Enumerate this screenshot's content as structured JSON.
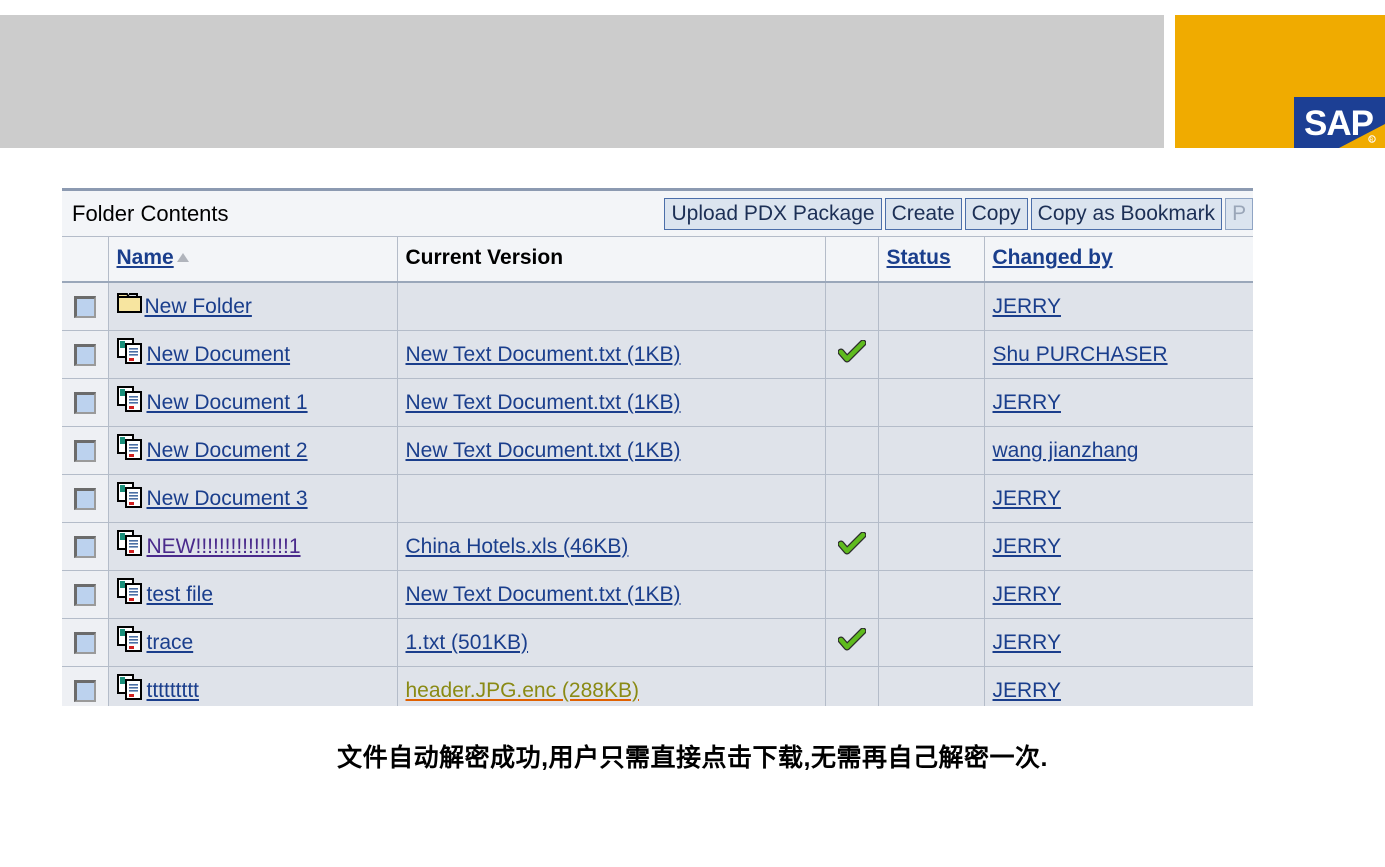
{
  "branding": {
    "logo_text": "SAP",
    "gold_color": "#f0ab00",
    "logo_blue": "#1c3f94",
    "banner_grey": "#cccccc"
  },
  "toolbar": {
    "title": "Folder Contents",
    "buttons": [
      {
        "label": "Upload PDX Package",
        "disabled": false
      },
      {
        "label": "Create",
        "disabled": false
      },
      {
        "label": "Copy",
        "disabled": false
      },
      {
        "label": "Copy as Bookmark",
        "disabled": false
      },
      {
        "label": "P",
        "disabled": true
      }
    ]
  },
  "table": {
    "columns": [
      {
        "key": "select",
        "label": "",
        "sortable": false
      },
      {
        "key": "name",
        "label": "Name",
        "sortable": true,
        "sorted": "asc"
      },
      {
        "key": "current_version",
        "label": "Current Version",
        "sortable": false
      },
      {
        "key": "flag",
        "label": "",
        "sortable": false
      },
      {
        "key": "status",
        "label": "Status",
        "sortable": true
      },
      {
        "key": "changed_by",
        "label": "Changed by",
        "sortable": true
      }
    ],
    "rows": [
      {
        "checked": false,
        "icon": "folder-icon",
        "name": "New Folder",
        "name_state": "normal",
        "current_version": "",
        "version_state": "normal",
        "flag": "",
        "status": "",
        "changed_by": "JERRY"
      },
      {
        "checked": false,
        "icon": "document-stack-icon",
        "name": "New Document",
        "name_state": "normal",
        "current_version": "New Text Document.txt (1KB)",
        "version_state": "normal",
        "flag": "check-mark-icon",
        "status": "",
        "changed_by": "Shu PURCHASER"
      },
      {
        "checked": false,
        "icon": "document-stack-icon",
        "name": "New Document 1",
        "name_state": "normal",
        "current_version": "New Text Document.txt (1KB)",
        "version_state": "normal",
        "flag": "",
        "status": "",
        "changed_by": "JERRY"
      },
      {
        "checked": false,
        "icon": "document-stack-icon",
        "name": "New Document 2",
        "name_state": "normal",
        "current_version": "New Text Document.txt (1KB)",
        "version_state": "normal",
        "flag": "",
        "status": "",
        "changed_by": "wang jianzhang"
      },
      {
        "checked": false,
        "icon": "document-stack-icon",
        "name": "New Document 3",
        "name_state": "normal",
        "current_version": "",
        "version_state": "normal",
        "flag": "",
        "status": "",
        "changed_by": "JERRY"
      },
      {
        "checked": false,
        "icon": "document-stack-icon",
        "name": "NEW!!!!!!!!!!!!!!!!1",
        "name_state": "visited",
        "current_version": "China Hotels.xls (46KB)",
        "version_state": "normal",
        "flag": "check-mark-icon",
        "status": "",
        "changed_by": "JERRY"
      },
      {
        "checked": false,
        "icon": "document-stack-icon",
        "name": "test file",
        "name_state": "normal",
        "current_version": "New Text Document.txt (1KB)",
        "version_state": "normal",
        "flag": "",
        "status": "",
        "changed_by": "JERRY"
      },
      {
        "checked": false,
        "icon": "document-stack-icon",
        "name": "trace",
        "name_state": "normal",
        "current_version": "1.txt (501KB)",
        "version_state": "normal",
        "flag": "check-mark-icon",
        "status": "",
        "changed_by": "JERRY"
      },
      {
        "checked": false,
        "icon": "document-stack-icon",
        "name": "ttttttttt",
        "name_state": "normal",
        "current_version": "header.JPG.enc (288KB)",
        "version_state": "hot",
        "flag": "",
        "status": "",
        "changed_by": "JERRY"
      }
    ]
  },
  "caption": {
    "text": "文件自动解密成功,用户只需直接点击下载,无需再自己解密一次."
  }
}
